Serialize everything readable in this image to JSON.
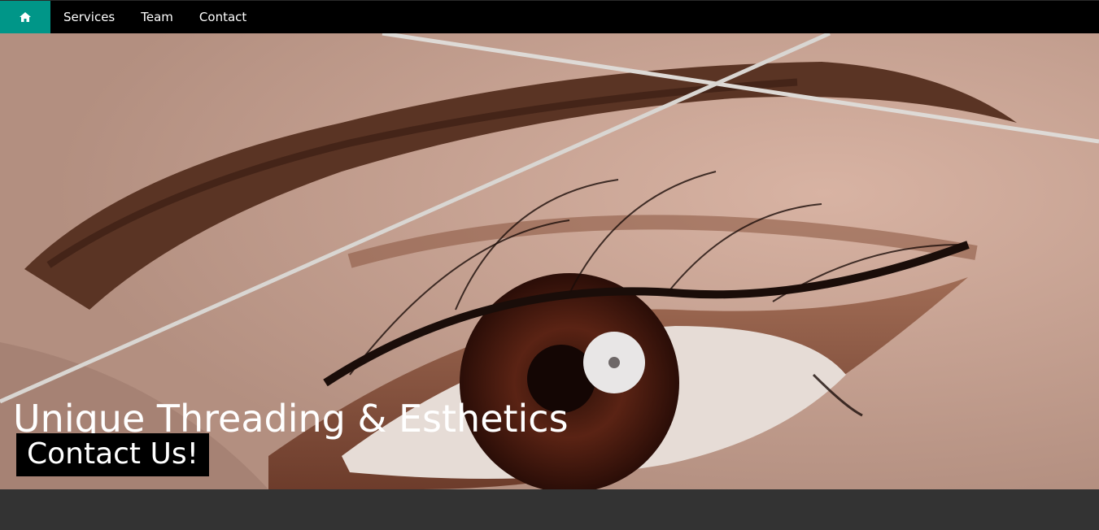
{
  "nav": {
    "home_icon": "home-icon",
    "links": [
      "Services",
      "Team",
      "Contact"
    ]
  },
  "hero": {
    "image": "close-up-eye-with-threaded-eyebrow",
    "title": "Unique Threading & Esthetics",
    "button_label": "Contact Us!"
  },
  "colors": {
    "accent": "#009688",
    "navbar": "#000000",
    "footer": "#333333",
    "text": "#ffffff"
  }
}
